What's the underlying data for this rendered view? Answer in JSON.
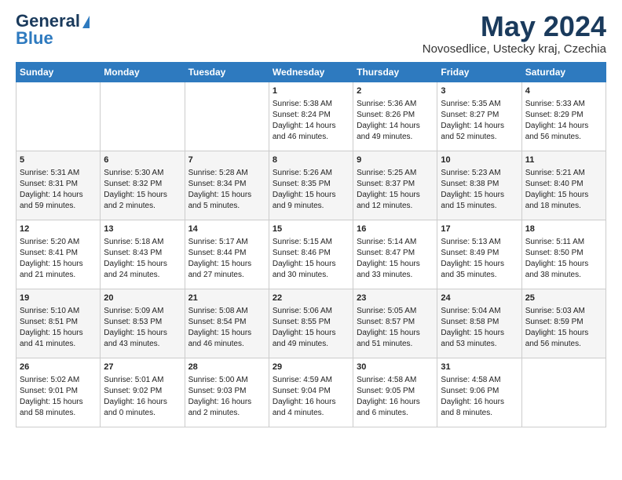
{
  "logo": {
    "line1": "General",
    "line2": "Blue"
  },
  "title": "May 2024",
  "location": "Novosedlice, Ustecky kraj, Czechia",
  "days_header": [
    "Sunday",
    "Monday",
    "Tuesday",
    "Wednesday",
    "Thursday",
    "Friday",
    "Saturday"
  ],
  "weeks": [
    [
      {
        "day": "",
        "content": ""
      },
      {
        "day": "",
        "content": ""
      },
      {
        "day": "",
        "content": ""
      },
      {
        "day": "1",
        "content": "Sunrise: 5:38 AM\nSunset: 8:24 PM\nDaylight: 14 hours\nand 46 minutes."
      },
      {
        "day": "2",
        "content": "Sunrise: 5:36 AM\nSunset: 8:26 PM\nDaylight: 14 hours\nand 49 minutes."
      },
      {
        "day": "3",
        "content": "Sunrise: 5:35 AM\nSunset: 8:27 PM\nDaylight: 14 hours\nand 52 minutes."
      },
      {
        "day": "4",
        "content": "Sunrise: 5:33 AM\nSunset: 8:29 PM\nDaylight: 14 hours\nand 56 minutes."
      }
    ],
    [
      {
        "day": "5",
        "content": "Sunrise: 5:31 AM\nSunset: 8:31 PM\nDaylight: 14 hours\nand 59 minutes."
      },
      {
        "day": "6",
        "content": "Sunrise: 5:30 AM\nSunset: 8:32 PM\nDaylight: 15 hours\nand 2 minutes."
      },
      {
        "day": "7",
        "content": "Sunrise: 5:28 AM\nSunset: 8:34 PM\nDaylight: 15 hours\nand 5 minutes."
      },
      {
        "day": "8",
        "content": "Sunrise: 5:26 AM\nSunset: 8:35 PM\nDaylight: 15 hours\nand 9 minutes."
      },
      {
        "day": "9",
        "content": "Sunrise: 5:25 AM\nSunset: 8:37 PM\nDaylight: 15 hours\nand 12 minutes."
      },
      {
        "day": "10",
        "content": "Sunrise: 5:23 AM\nSunset: 8:38 PM\nDaylight: 15 hours\nand 15 minutes."
      },
      {
        "day": "11",
        "content": "Sunrise: 5:21 AM\nSunset: 8:40 PM\nDaylight: 15 hours\nand 18 minutes."
      }
    ],
    [
      {
        "day": "12",
        "content": "Sunrise: 5:20 AM\nSunset: 8:41 PM\nDaylight: 15 hours\nand 21 minutes."
      },
      {
        "day": "13",
        "content": "Sunrise: 5:18 AM\nSunset: 8:43 PM\nDaylight: 15 hours\nand 24 minutes."
      },
      {
        "day": "14",
        "content": "Sunrise: 5:17 AM\nSunset: 8:44 PM\nDaylight: 15 hours\nand 27 minutes."
      },
      {
        "day": "15",
        "content": "Sunrise: 5:15 AM\nSunset: 8:46 PM\nDaylight: 15 hours\nand 30 minutes."
      },
      {
        "day": "16",
        "content": "Sunrise: 5:14 AM\nSunset: 8:47 PM\nDaylight: 15 hours\nand 33 minutes."
      },
      {
        "day": "17",
        "content": "Sunrise: 5:13 AM\nSunset: 8:49 PM\nDaylight: 15 hours\nand 35 minutes."
      },
      {
        "day": "18",
        "content": "Sunrise: 5:11 AM\nSunset: 8:50 PM\nDaylight: 15 hours\nand 38 minutes."
      }
    ],
    [
      {
        "day": "19",
        "content": "Sunrise: 5:10 AM\nSunset: 8:51 PM\nDaylight: 15 hours\nand 41 minutes."
      },
      {
        "day": "20",
        "content": "Sunrise: 5:09 AM\nSunset: 8:53 PM\nDaylight: 15 hours\nand 43 minutes."
      },
      {
        "day": "21",
        "content": "Sunrise: 5:08 AM\nSunset: 8:54 PM\nDaylight: 15 hours\nand 46 minutes."
      },
      {
        "day": "22",
        "content": "Sunrise: 5:06 AM\nSunset: 8:55 PM\nDaylight: 15 hours\nand 49 minutes."
      },
      {
        "day": "23",
        "content": "Sunrise: 5:05 AM\nSunset: 8:57 PM\nDaylight: 15 hours\nand 51 minutes."
      },
      {
        "day": "24",
        "content": "Sunrise: 5:04 AM\nSunset: 8:58 PM\nDaylight: 15 hours\nand 53 minutes."
      },
      {
        "day": "25",
        "content": "Sunrise: 5:03 AM\nSunset: 8:59 PM\nDaylight: 15 hours\nand 56 minutes."
      }
    ],
    [
      {
        "day": "26",
        "content": "Sunrise: 5:02 AM\nSunset: 9:01 PM\nDaylight: 15 hours\nand 58 minutes."
      },
      {
        "day": "27",
        "content": "Sunrise: 5:01 AM\nSunset: 9:02 PM\nDaylight: 16 hours\nand 0 minutes."
      },
      {
        "day": "28",
        "content": "Sunrise: 5:00 AM\nSunset: 9:03 PM\nDaylight: 16 hours\nand 2 minutes."
      },
      {
        "day": "29",
        "content": "Sunrise: 4:59 AM\nSunset: 9:04 PM\nDaylight: 16 hours\nand 4 minutes."
      },
      {
        "day": "30",
        "content": "Sunrise: 4:58 AM\nSunset: 9:05 PM\nDaylight: 16 hours\nand 6 minutes."
      },
      {
        "day": "31",
        "content": "Sunrise: 4:58 AM\nSunset: 9:06 PM\nDaylight: 16 hours\nand 8 minutes."
      },
      {
        "day": "",
        "content": ""
      }
    ]
  ]
}
